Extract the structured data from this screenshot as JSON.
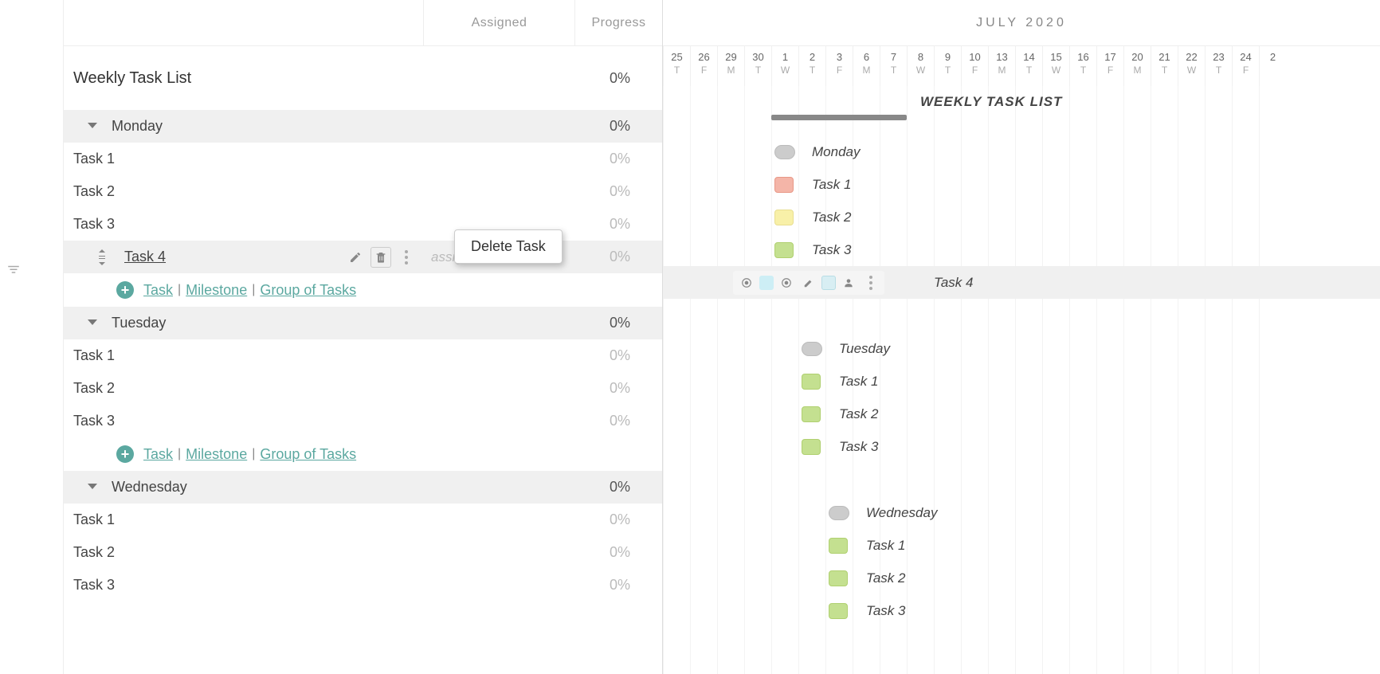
{
  "headers": {
    "assigned": "Assigned",
    "progress": "Progress"
  },
  "month": "JULY 2020",
  "calendar": [
    {
      "n": "25",
      "d": "T"
    },
    {
      "n": "26",
      "d": "F"
    },
    {
      "n": "29",
      "d": "M"
    },
    {
      "n": "30",
      "d": "T"
    },
    {
      "n": "1",
      "d": "W"
    },
    {
      "n": "2",
      "d": "T"
    },
    {
      "n": "3",
      "d": "F"
    },
    {
      "n": "6",
      "d": "M"
    },
    {
      "n": "7",
      "d": "T"
    },
    {
      "n": "8",
      "d": "W"
    },
    {
      "n": "9",
      "d": "T"
    },
    {
      "n": "10",
      "d": "F"
    },
    {
      "n": "13",
      "d": "M"
    },
    {
      "n": "14",
      "d": "T"
    },
    {
      "n": "15",
      "d": "W"
    },
    {
      "n": "16",
      "d": "T"
    },
    {
      "n": "17",
      "d": "F"
    },
    {
      "n": "20",
      "d": "M"
    },
    {
      "n": "21",
      "d": "T"
    },
    {
      "n": "22",
      "d": "W"
    },
    {
      "n": "23",
      "d": "T"
    },
    {
      "n": "24",
      "d": "F"
    },
    {
      "n": "2",
      "d": ""
    }
  ],
  "project": {
    "title": "Weekly Task List",
    "progress": "0%",
    "gantt_label": "WEEKLY TASK LIST"
  },
  "tooltip": "Delete Task",
  "assign_placeholder": "assign",
  "add": {
    "task": "Task",
    "milestone": "Milestone",
    "group": "Group of Tasks"
  },
  "groups": [
    {
      "name": "Monday",
      "progress": "0%",
      "tasks": [
        {
          "name": "Task 1",
          "progress": "0%",
          "color": "c-red"
        },
        {
          "name": "Task 2",
          "progress": "0%",
          "color": "c-yellow"
        },
        {
          "name": "Task 3",
          "progress": "0%",
          "color": "c-green"
        },
        {
          "name": "Task 4",
          "progress": "0%",
          "color": "c-cyan",
          "selected": true
        }
      ],
      "add": true,
      "col": 4
    },
    {
      "name": "Tuesday",
      "progress": "0%",
      "tasks": [
        {
          "name": "Task 1",
          "progress": "0%",
          "color": "c-green"
        },
        {
          "name": "Task 2",
          "progress": "0%",
          "color": "c-green"
        },
        {
          "name": "Task 3",
          "progress": "0%",
          "color": "c-green"
        }
      ],
      "add": true,
      "col": 5
    },
    {
      "name": "Wednesday",
      "progress": "0%",
      "tasks": [
        {
          "name": "Task 1",
          "progress": "0%",
          "color": "c-green"
        },
        {
          "name": "Task 2",
          "progress": "0%",
          "color": "c-green"
        },
        {
          "name": "Task 3",
          "progress": "0%",
          "color": "c-green"
        }
      ],
      "add": false,
      "col": 6
    }
  ]
}
